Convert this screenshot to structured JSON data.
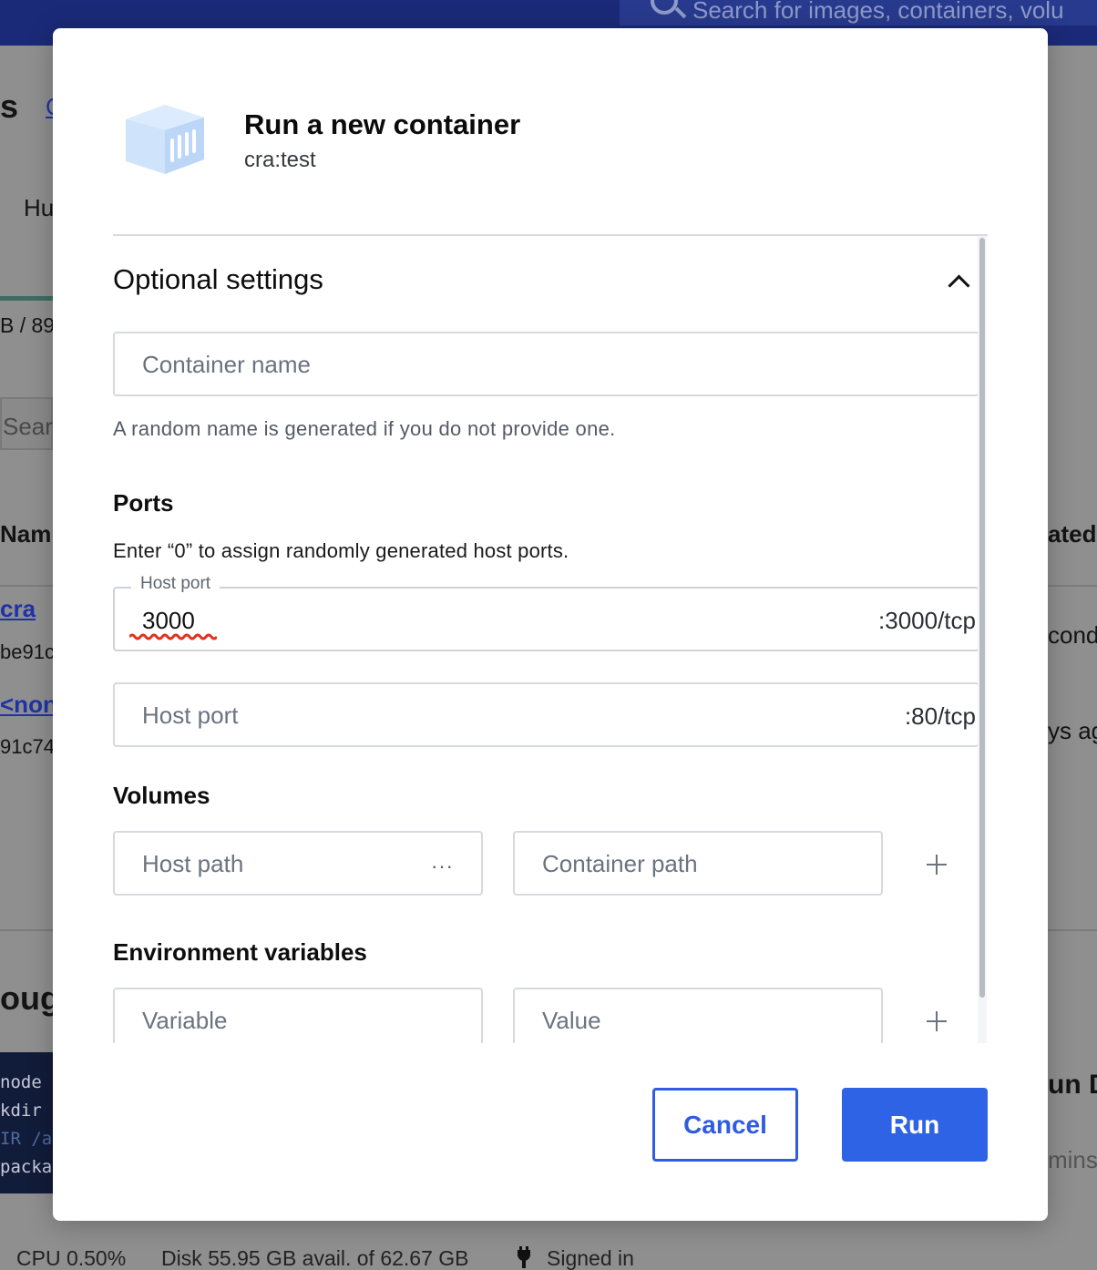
{
  "background": {
    "search_placeholder": "Search for images, containers, volu",
    "frag_s": "s",
    "frag_link": "C",
    "frag_hub": "Hu",
    "frag_size": "B / 89",
    "frag_search": "Sear",
    "frag_name_header": "Nam",
    "frag_created_header": "ated",
    "frag_row1_name": "cra",
    "frag_row1_id": "be91c",
    "frag_row1_time": "cond",
    "frag_row2_name": "<non",
    "frag_row2_id": "91c74",
    "frag_row2_time": "ys ag",
    "frag_through": "oug",
    "frag_run": "un D",
    "frag_mins": "mins",
    "terminal_lines": [
      "node",
      "kdir",
      "IR /a",
      "packa"
    ],
    "status": {
      "cpu": "CPU 0.50%",
      "disk": "Disk 55.95 GB avail. of 62.67 GB",
      "signed_in": "Signed in"
    }
  },
  "dialog": {
    "title": "Run a new container",
    "image": "cra:test",
    "optional_settings": {
      "title": "Optional settings",
      "container_name_placeholder": "Container name",
      "container_name_hint": "A random name is generated if you do not provide one."
    },
    "ports": {
      "title": "Ports",
      "description": "Enter “0” to assign randomly generated host ports.",
      "rows": [
        {
          "label": "Host port",
          "value": "3000",
          "container_port": ":3000/tcp"
        },
        {
          "placeholder": "Host port",
          "value": "",
          "container_port": ":80/tcp"
        }
      ]
    },
    "volumes": {
      "title": "Volumes",
      "host_path_placeholder": "Host path",
      "container_path_placeholder": "Container path",
      "browse_label": "···"
    },
    "env": {
      "title": "Environment variables",
      "variable_placeholder": "Variable",
      "value_placeholder": "Value"
    },
    "buttons": {
      "cancel": "Cancel",
      "run": "Run"
    }
  },
  "colors": {
    "primary": "#2e63e6",
    "topbar": "#1b2a78",
    "overlay": "#8f8f8f",
    "annotation_underline": "#e0321e"
  }
}
